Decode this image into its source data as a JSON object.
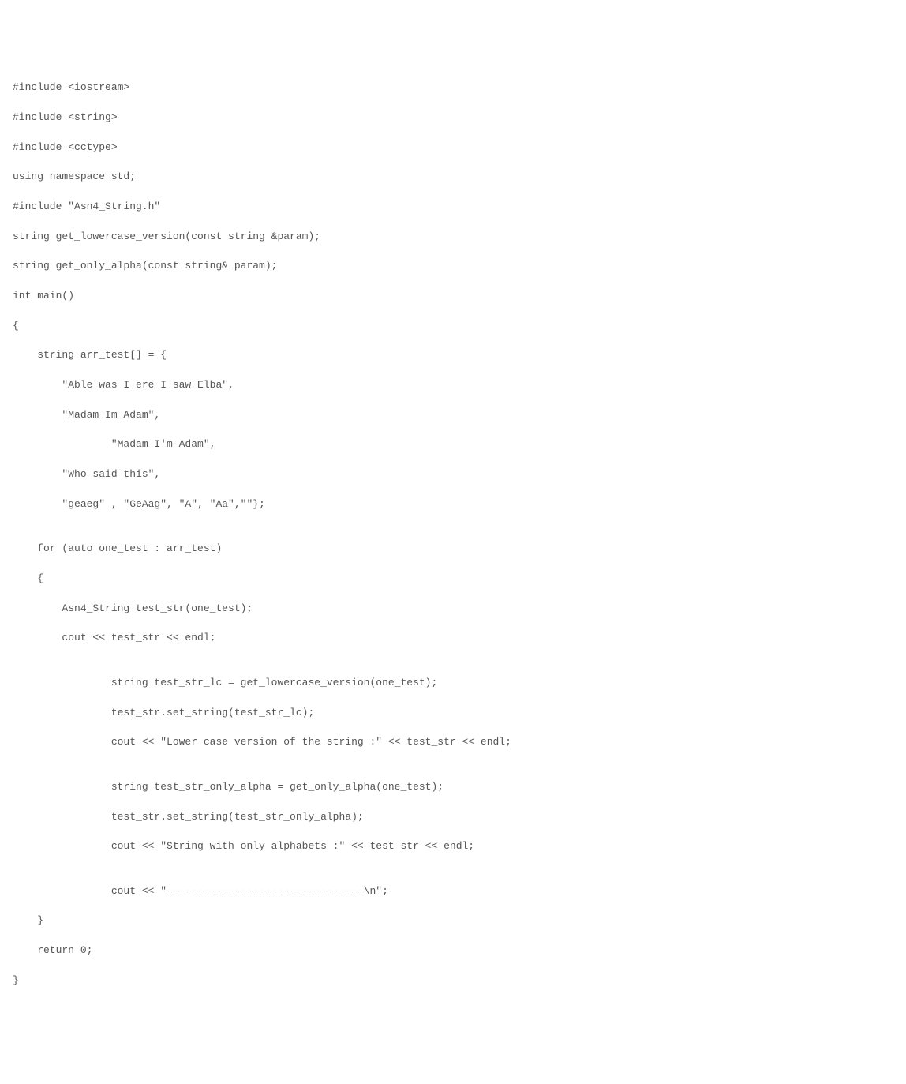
{
  "code": {
    "lines": [
      "#include <iostream>",
      "#include <string>",
      "#include <cctype>",
      "using namespace std;",
      "#include \"Asn4_String.h\"",
      "string get_lowercase_version(const string &param);",
      "string get_only_alpha(const string& param);",
      "int main()",
      "{",
      "    string arr_test[] = {",
      "        \"Able was I ere I saw Elba\",",
      "        \"Madam Im Adam\",",
      "                \"Madam I'm Adam\",",
      "        \"Who said this\",",
      "        \"geaeg\" , \"GeAag\", \"A\", \"Aa\",\"\"};",
      "",
      "    for (auto one_test : arr_test)",
      "    {",
      "        Asn4_String test_str(one_test);",
      "        cout << test_str << endl;",
      "",
      "                string test_str_lc = get_lowercase_version(one_test);",
      "                test_str.set_string(test_str_lc);",
      "                cout << \"Lower case version of the string :\" << test_str << endl;",
      "",
      "                string test_str_only_alpha = get_only_alpha(one_test);",
      "                test_str.set_string(test_str_only_alpha);",
      "                cout << \"String with only alphabets :\" << test_str << endl;",
      "",
      "                cout << \"--------------------------------\\n\";",
      "    }",
      "    return 0;",
      "}"
    ]
  }
}
